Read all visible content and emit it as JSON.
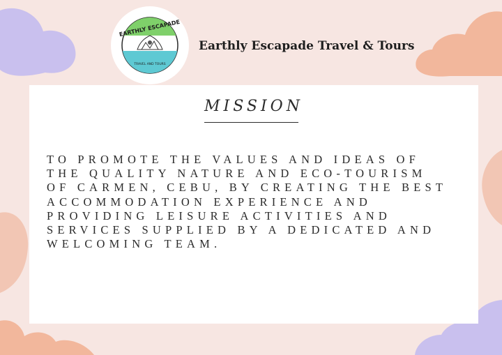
{
  "brand": {
    "name": "Earthly Escapade Travel & Tours",
    "logo_text_top": "EARTHLY ESCAPADE",
    "logo_text_bottom": "TRAVEL AND TOURS"
  },
  "card": {
    "heading": "MISSION",
    "body_lines": [
      "TO PROMOTE THE VALUES AND IDEAS OF",
      "THE QUALITY NATURE AND ECO-TOURISM",
      "OF CARMEN, CEBU, BY CREATING THE BEST",
      "ACCOMMODATION EXPERIENCE AND",
      "PROVIDING LEISURE ACTIVITIES AND",
      "SERVICES SUPPLIED BY A DEDICATED AND",
      "WELCOMING TEAM."
    ]
  },
  "colors": {
    "background": "#f7e6e2",
    "blob_purple": "#c9c0ee",
    "blob_peach": "#f2b79c",
    "logo_green": "#7fd06a",
    "logo_teal": "#5ec9d3"
  }
}
